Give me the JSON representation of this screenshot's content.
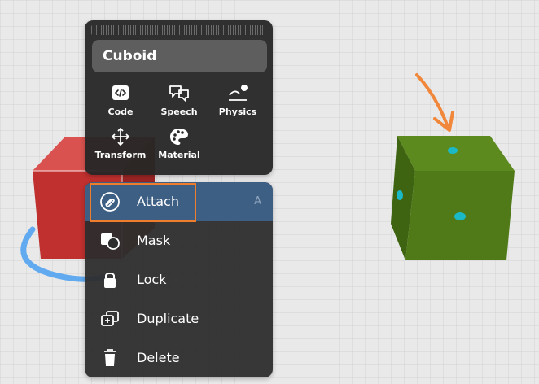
{
  "object_panel": {
    "name": "Cuboid",
    "tools": [
      {
        "label": "Code",
        "icon": "code-icon"
      },
      {
        "label": "Speech",
        "icon": "speech-icon"
      },
      {
        "label": "Physics",
        "icon": "physics-icon"
      },
      {
        "label": "Transform",
        "icon": "transform-icon"
      },
      {
        "label": "Material",
        "icon": "palette-icon"
      }
    ]
  },
  "context_menu": {
    "items": [
      {
        "label": "Attach",
        "icon": "attach-icon",
        "shortcut": "A",
        "highlighted": true
      },
      {
        "label": "Mask",
        "icon": "mask-icon"
      },
      {
        "label": "Lock",
        "icon": "lock-icon"
      },
      {
        "label": "Duplicate",
        "icon": "duplicate-icon"
      },
      {
        "label": "Delete",
        "icon": "trash-icon"
      }
    ]
  },
  "colors": {
    "panel_bg": "#262626",
    "menu_active": "#3e5f84",
    "highlight_border": "#f07d2b",
    "red_cube": "#c0302f",
    "green_cube": "#4f7a17",
    "attach_arrow": "#f0873a",
    "snap_dots": "#1bb8c6",
    "gizmo_ring": "#5aa7f0"
  }
}
